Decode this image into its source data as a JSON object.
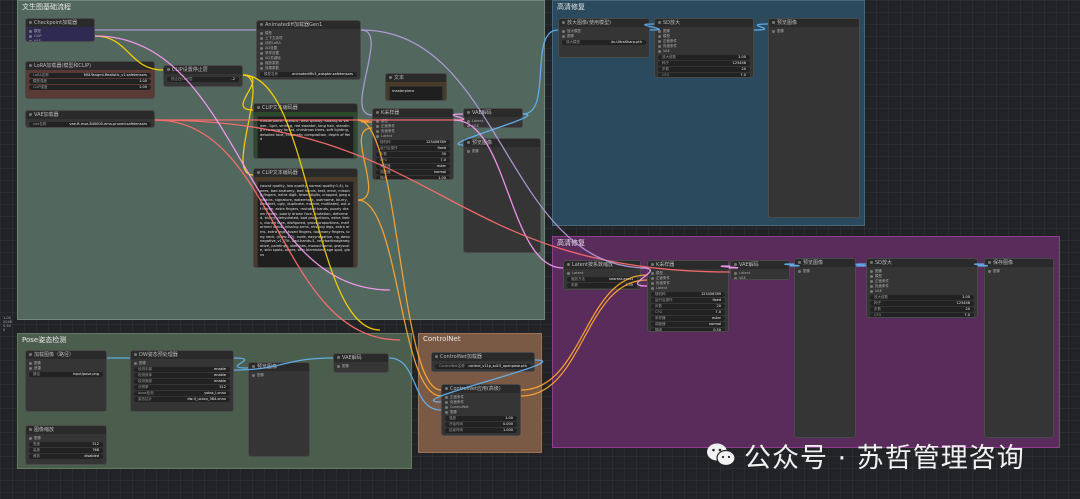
{
  "groups": {
    "main": "文生图基础流程",
    "pose": "Pose姿态检测",
    "controlnet": "ControlNet",
    "upscale1": "高清修复",
    "upscale2": "高清修复"
  },
  "nodes": {
    "checkpoint": {
      "title": "Checkpoint加载器",
      "rows": [
        {
          "l": "模型"
        },
        {
          "l": "CLIP"
        },
        {
          "l": "VAE"
        }
      ],
      "widgets": [
        {
          "l": "Ckpt名称",
          "v": "majicMIX realistic v7.safetensors"
        }
      ]
    },
    "lora": {
      "title": "LoRA加载器(模型和CLIP)",
      "widgets": [
        {
          "l": "LoRA名称",
          "v": "MIX-Yangmi-Realistic_v1.safetensors"
        },
        {
          "l": "模型强度",
          "v": "1.00"
        },
        {
          "l": "CLIP强度",
          "v": "1.00"
        }
      ]
    },
    "vae_loader": {
      "title": "VAE加载器",
      "widgets": [
        {
          "l": "vae名称",
          "v": "vae-ft-mse-840000-ema-pruned.safetensors"
        }
      ]
    },
    "clip_skip": {
      "title": "CLIP设置停止层",
      "widgets": [
        {
          "l": "停止在CLIP层",
          "v": "-2"
        }
      ]
    },
    "eff_loader": {
      "title": "Animatediff加载器Gen1",
      "rows": [
        {
          "l": "模型"
        },
        {
          "l": "上下文选项"
        },
        {
          "l": "动作LoRA"
        },
        {
          "l": "AD设置"
        },
        {
          "l": "采样设置"
        },
        {
          "l": "AD关键帧"
        },
        {
          "l": "缩放乘数"
        },
        {
          "l": "效果乘数"
        }
      ],
      "widgets": [
        {
          "l": "模型名称",
          "v": "animatediffv3_adapter.safetensors"
        }
      ]
    },
    "text_node": {
      "title": "文本",
      "text": "masterpiece"
    },
    "pos_prompt": {
      "title": "CLIP文本编码器",
      "text": "masterpiece, realistic, best quality, looking at viewer, 1girl, smiling, red sweater, long hair, standing in a snowy forest, christmas trees, soft lighting, detailed face, cinematic composition, depth of field"
    },
    "neg_prompt": {
      "title": "CLIP文本编码器",
      "text": "(worst quality, low quality, normal quality:1.4), lowres, bad anatomy, bad hands, text, error, missing fingers, extra digit, fewer digits, cropped, jpeg artifacts, signature, watermark, username, blurry, bad feet, ugly, duplicate, morbid, mutilated, out of frame, extra fingers, mutated hands, poorly drawn hands, poorly drawn face, mutation, deformed, blurry, dehydrated, bad proportions, extra limbs, cloned face, disfigured, gross proportions, malformed limbs, missing arms, missing legs, extra arms, extra legs, fused fingers, too many fingers, long neck, (nsfw:1.2), nude, easynegative, ng_deepnegative_v1_75t, bad-hands-5, verybadimagenegative, paintings, sketches, monochrome, grayscale, skin spots, acnes, skin blemishes, age spot, glans"
    },
    "ksampler": {
      "title": "K采样器",
      "rows": [
        {
          "l": "模型"
        },
        {
          "l": "正面条件"
        },
        {
          "l": "负面条件"
        },
        {
          "l": "Latent"
        }
      ],
      "widgets": [
        {
          "l": "随机种",
          "v": "123456789"
        },
        {
          "l": "运行后操作",
          "v": "fixed"
        },
        {
          "l": "步数",
          "v": "30"
        },
        {
          "l": "CFG",
          "v": "7.0"
        },
        {
          "l": "采样器",
          "v": "euler"
        },
        {
          "l": "调度器",
          "v": "normal"
        },
        {
          "l": "降噪",
          "v": "1.00"
        }
      ]
    },
    "vae_decode": {
      "title": "VAE解码",
      "rows": [
        {
          "l": "Latent"
        },
        {
          "l": "VAE"
        }
      ],
      "out": "图像"
    },
    "preview1": {
      "title": "预览图像",
      "rows": [
        {
          "l": "图像"
        }
      ]
    },
    "pose_load": {
      "title": "加载图像（路径）",
      "rows": [
        {
          "l": "图像"
        },
        {
          "l": "遮罩"
        }
      ],
      "widgets": [
        {
          "l": "路径",
          "v": "input/pose.png"
        }
      ]
    },
    "pose_detect": {
      "title": "DW姿态预处理器",
      "rows": [
        {
          "l": "图像"
        }
      ],
      "widgets": [
        {
          "l": "检测手部",
          "v": "enable"
        },
        {
          "l": "检测身体",
          "v": "enable"
        },
        {
          "l": "检测面部",
          "v": "enable"
        },
        {
          "l": "分辨率",
          "v": "512"
        },
        {
          "l": "bbox检测",
          "v": "yolox_l.onnx"
        },
        {
          "l": "姿态估计",
          "v": "dw-ll_ucoco_384.onnx"
        }
      ]
    },
    "pose_resize": {
      "title": "图像缩放",
      "rows": [
        {
          "l": "图像"
        }
      ],
      "widgets": [
        {
          "l": "宽度",
          "v": "512"
        },
        {
          "l": "高度",
          "v": "768"
        },
        {
          "l": "裁剪",
          "v": "disabled"
        }
      ]
    },
    "pose_preview": {
      "title": "预览图像",
      "rows": [
        {
          "l": "图像"
        }
      ]
    },
    "reroute": {
      "title": "VAE解码",
      "rows": [
        {
          "l": "图像"
        }
      ]
    },
    "cn_loader": {
      "title": "ControlNet加载器",
      "widgets": [
        {
          "l": "ControlNet名称",
          "v": "control_v11p_sd15_openpose.pth"
        }
      ]
    },
    "cn_apply": {
      "title": "ControlNet应用(高级)",
      "rows": [
        {
          "l": "正面条件"
        },
        {
          "l": "负面条件"
        },
        {
          "l": "ControlNet"
        },
        {
          "l": "图像"
        }
      ],
      "widgets": [
        {
          "l": "强度",
          "v": "1.00"
        },
        {
          "l": "开始时间",
          "v": "0.000"
        },
        {
          "l": "结束时间",
          "v": "1.000"
        }
      ]
    },
    "up_model": {
      "title": "放大图像(使用模型)",
      "rows": [
        {
          "l": "放大模型"
        },
        {
          "l": "图像"
        }
      ],
      "widgets": [
        {
          "l": "放大模型",
          "v": "4x-UltraSharp.pth"
        }
      ]
    },
    "up_sd": {
      "title": "SD放大",
      "rows": [
        {
          "l": "图像"
        },
        {
          "l": "模型"
        },
        {
          "l": "正面条件"
        },
        {
          "l": "负面条件"
        },
        {
          "l": "VAE"
        }
      ],
      "widgets": [
        {
          "l": "放大倍数",
          "v": "2.00"
        },
        {
          "l": "种子",
          "v": "123456"
        },
        {
          "l": "步数",
          "v": "20"
        },
        {
          "l": "CFG",
          "v": "7.0"
        },
        {
          "l": "降噪",
          "v": "0.35"
        }
      ]
    },
    "up_preview": {
      "title": "预览图像",
      "rows": [
        {
          "l": "图像"
        }
      ]
    },
    "up2_latent": {
      "title": "Latent按系数缩放",
      "rows": [
        {
          "l": "Latent"
        }
      ],
      "widgets": [
        {
          "l": "缩放方法",
          "v": "nearest-exact"
        },
        {
          "l": "系数",
          "v": "1.50"
        }
      ]
    },
    "up2_ksampler": {
      "title": "K采样器",
      "rows": [
        {
          "l": "模型"
        },
        {
          "l": "正面条件"
        },
        {
          "l": "负面条件"
        },
        {
          "l": "Latent"
        }
      ],
      "widgets": [
        {
          "l": "随机种",
          "v": "123456789"
        },
        {
          "l": "运行后操作",
          "v": "fixed"
        },
        {
          "l": "步数",
          "v": "20"
        },
        {
          "l": "CFG",
          "v": "7.0"
        },
        {
          "l": "采样器",
          "v": "euler"
        },
        {
          "l": "调度器",
          "v": "normal"
        },
        {
          "l": "降噪",
          "v": "0.50"
        }
      ]
    },
    "up2_decode": {
      "title": "VAE解码",
      "rows": [
        {
          "l": "Latent"
        },
        {
          "l": "VAE"
        }
      ]
    },
    "up2_preview": {
      "title": "预览图像",
      "rows": [
        {
          "l": "图像"
        }
      ]
    },
    "up2_sd": {
      "title": "SD放大",
      "rows": [
        {
          "l": "图像"
        },
        {
          "l": "模型"
        },
        {
          "l": "正面条件"
        },
        {
          "l": "负面条件"
        },
        {
          "l": "VAE"
        }
      ],
      "widgets": [
        {
          "l": "放大倍数",
          "v": "2.00"
        },
        {
          "l": "种子",
          "v": "123456"
        },
        {
          "l": "步数",
          "v": "20"
        },
        {
          "l": "CFG",
          "v": "7.0"
        },
        {
          "l": "降噪",
          "v": "0.30"
        }
      ]
    },
    "up2_final": {
      "title": "保存图像",
      "rows": [
        {
          "l": "图像"
        }
      ]
    }
  },
  "side_note": "1.00\n2048\n0.50\n0",
  "watermark": {
    "text": "公众号 · 苏哲管理咨询",
    "icon": "wechat-icon"
  },
  "colors": {
    "wire_model": "#b39ddb",
    "wire_clip": "#ffd500",
    "wire_vae": "#ff6e6e",
    "wire_cond": "#ffa931",
    "wire_latent": "#ff9cf9",
    "wire_image": "#64b5f6"
  }
}
